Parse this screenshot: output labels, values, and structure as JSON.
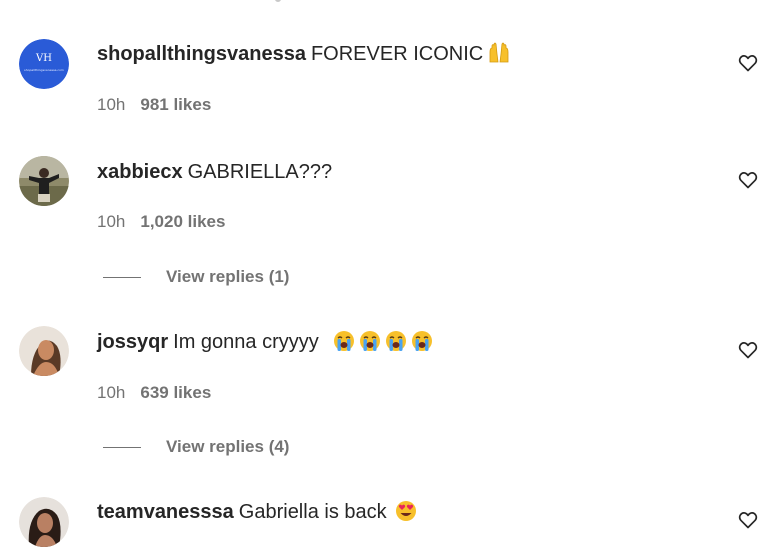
{
  "comments": [
    {
      "username": "shopallthingsvanessa",
      "text": "FOREVER ICONIC",
      "emoji": [
        "raising-hands"
      ],
      "time": "10h",
      "likes": "981 likes",
      "avatar_text": "shopallthingsvanessa.com",
      "avatar_color": "#2a5bd7"
    },
    {
      "username": "xabbiecx",
      "text": "GABRIELLA???",
      "time": "10h",
      "likes": "1,020 likes",
      "replies": "View replies (1)"
    },
    {
      "username": "jossyqr",
      "text": "Im gonna cryyyy",
      "emoji": [
        "loudly-crying-face",
        "loudly-crying-face",
        "loudly-crying-face",
        "loudly-crying-face"
      ],
      "time": "10h",
      "likes": "639 likes",
      "replies": "View replies (4)"
    },
    {
      "username": "teamvanesssa",
      "text": "Gabriella is back",
      "emoji": [
        "heart-eyes-face"
      ]
    }
  ],
  "colors": {
    "text": "#262626",
    "secondary": "#737373",
    "emoji_yellow": "#f7c02b",
    "tear_blue": "#4aa3f0",
    "heart_red": "#e8265a"
  }
}
